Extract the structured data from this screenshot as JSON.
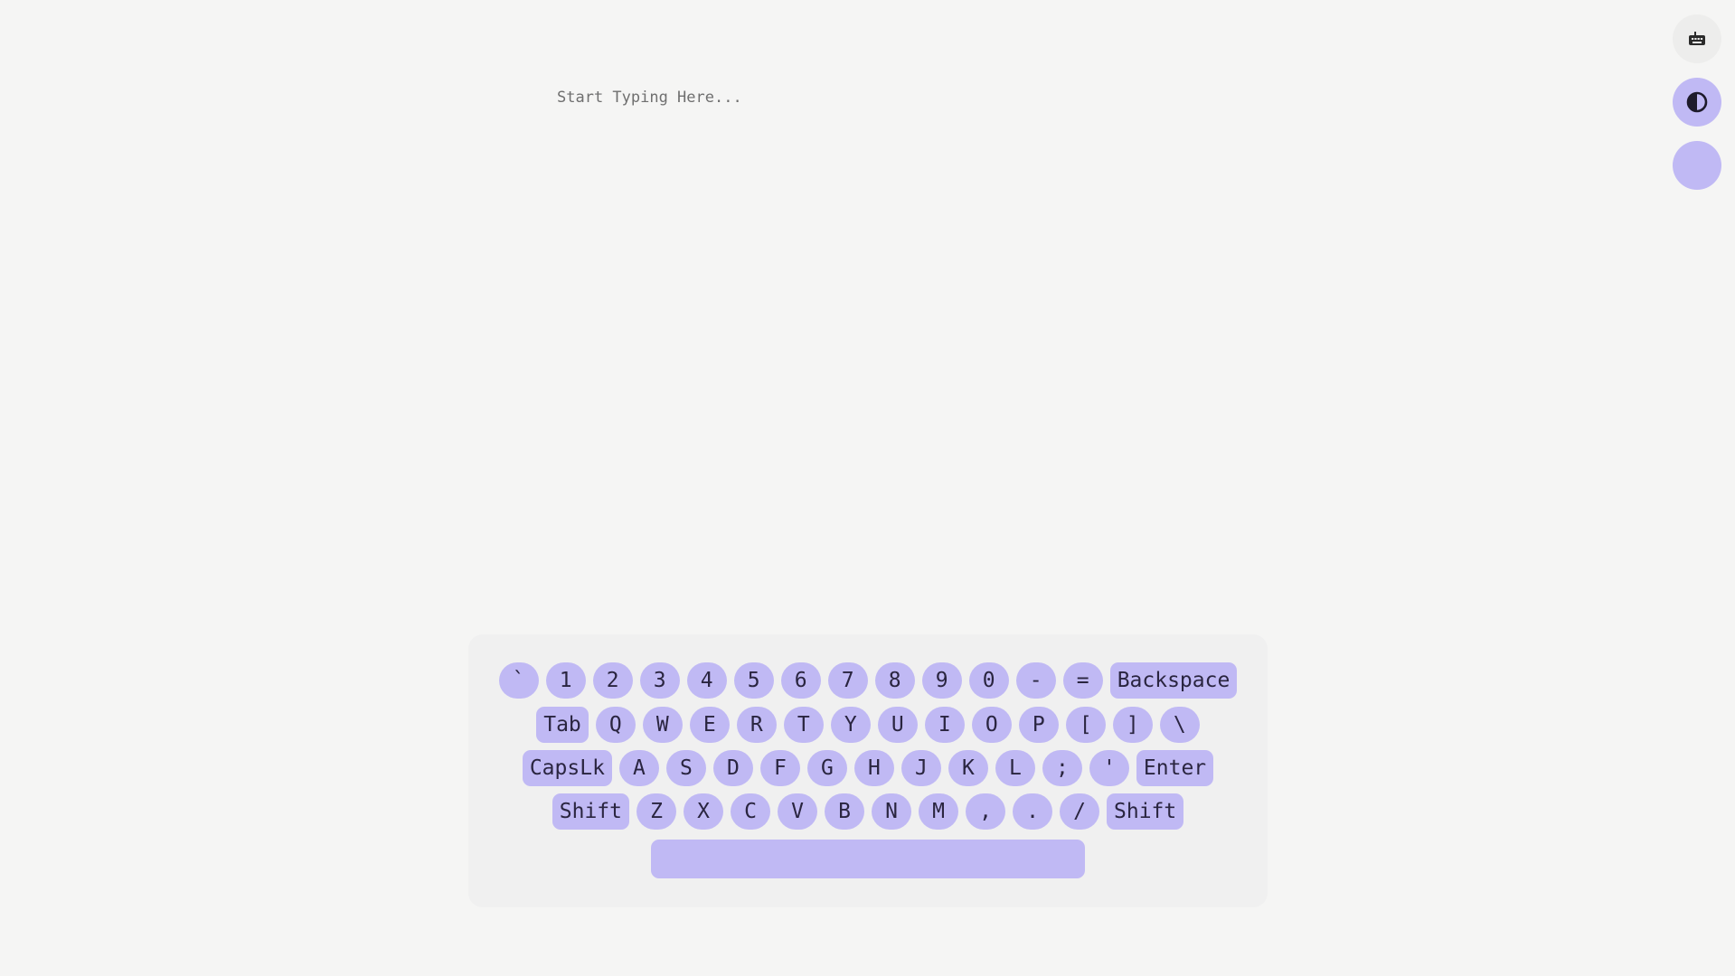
{
  "editor": {
    "placeholder": "Start Typing Here..."
  },
  "side_buttons": [
    {
      "name": "keyboard-toggle",
      "icon": "keyboard-icon"
    },
    {
      "name": "theme-toggle",
      "icon": "contrast-icon"
    },
    {
      "name": "color-swatch",
      "icon": ""
    }
  ],
  "colors": {
    "background": "#f5f5f4",
    "key": "#c0b9f4",
    "keyboard_panel": "#f0f0f0",
    "key_text": "#2a2540"
  },
  "keyboard": {
    "row1": [
      "`",
      "1",
      "2",
      "3",
      "4",
      "5",
      "6",
      "7",
      "8",
      "9",
      "0",
      "-",
      "=",
      "Backspace"
    ],
    "row2": [
      "Tab",
      "Q",
      "W",
      "E",
      "R",
      "T",
      "Y",
      "U",
      "I",
      "O",
      "P",
      "[",
      "]",
      "\\"
    ],
    "row3": [
      "CapsLk",
      "A",
      "S",
      "D",
      "F",
      "G",
      "H",
      "J",
      "K",
      "L",
      ";",
      "'",
      "Enter"
    ],
    "row4": [
      "Shift",
      "Z",
      "X",
      "C",
      "V",
      "B",
      "N",
      "M",
      ",",
      ".",
      "/",
      "Shift"
    ],
    "space": ""
  }
}
